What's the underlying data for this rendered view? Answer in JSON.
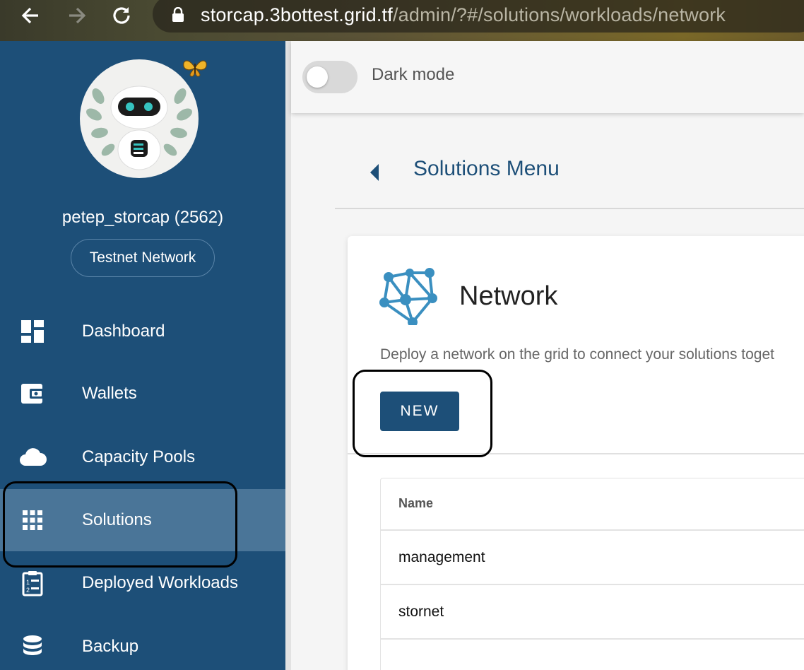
{
  "browser": {
    "url_host": "storcap.3bottest.grid.tf",
    "url_path": "/admin/?#/solutions/workloads/network"
  },
  "user": {
    "name": "petep_storcap (2562)",
    "network": "Testnet Network"
  },
  "sidebar": {
    "items": [
      {
        "label": "Dashboard",
        "icon": "dashboard-icon"
      },
      {
        "label": "Wallets",
        "icon": "wallet-icon"
      },
      {
        "label": "Capacity Pools",
        "icon": "cloud-icon"
      },
      {
        "label": "Solutions",
        "icon": "grid-apps-icon",
        "active": true
      },
      {
        "label": "Deployed Workloads",
        "icon": "clipboard-list-icon"
      },
      {
        "label": "Backup",
        "icon": "database-icon"
      }
    ]
  },
  "topbar": {
    "dark_mode_label": "Dark mode",
    "dark_mode_on": false
  },
  "main": {
    "breadcrumb_title": "Solutions Menu",
    "card": {
      "title": "Network",
      "description": "Deploy a network on the grid to connect your solutions toget",
      "new_button": "NEW",
      "table": {
        "header": "Name",
        "rows": [
          "management",
          "stornet",
          ""
        ]
      }
    }
  },
  "colors": {
    "sidebar": "#1d4f78",
    "sidebar_active": "#4a7598",
    "primary": "#1d4f78",
    "network_icon": "#3a8fc0"
  }
}
